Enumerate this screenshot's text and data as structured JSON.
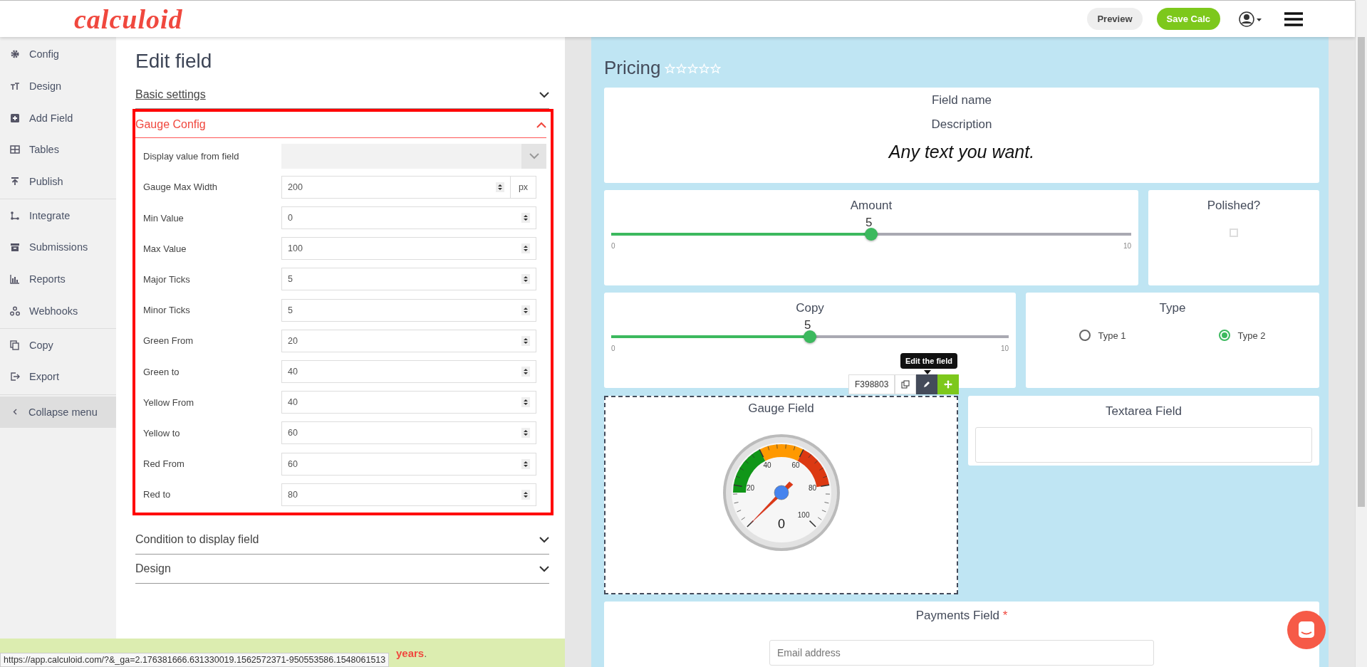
{
  "header": {
    "logo": "calculoid",
    "preview": "Preview",
    "save": "Save Calc"
  },
  "sidebar": {
    "groups": [
      [
        {
          "label": "Config"
        },
        {
          "label": "Design"
        },
        {
          "label": "Add Field"
        },
        {
          "label": "Tables"
        },
        {
          "label": "Publish"
        }
      ],
      [
        {
          "label": "Integrate"
        },
        {
          "label": "Submissions"
        },
        {
          "label": "Reports"
        },
        {
          "label": "Webhooks"
        }
      ],
      [
        {
          "label": "Copy"
        },
        {
          "label": "Export"
        }
      ]
    ],
    "collapse": "Collapse menu"
  },
  "editor": {
    "title": "Edit field",
    "sections": [
      {
        "title": "Basic settings",
        "expanded": false
      },
      {
        "title": "Gauge Config",
        "expanded": true,
        "fields": [
          {
            "kind": "select",
            "label": "Display value from field"
          },
          {
            "kind": "number",
            "label": "Gauge Max Width",
            "value": "200",
            "unit": "px"
          },
          {
            "kind": "number",
            "label": "Min Value",
            "value": "0"
          },
          {
            "kind": "number",
            "label": "Max Value",
            "value": "100"
          },
          {
            "kind": "number",
            "label": "Major Ticks",
            "value": "5"
          },
          {
            "kind": "number",
            "label": "Minor Ticks",
            "value": "5"
          },
          {
            "kind": "number",
            "label": "Green From",
            "value": "20"
          },
          {
            "kind": "number",
            "label": "Green to",
            "value": "40"
          },
          {
            "kind": "number",
            "label": "Yellow From",
            "value": "40"
          },
          {
            "kind": "number",
            "label": "Yellow to",
            "value": "60"
          },
          {
            "kind": "number",
            "label": "Red From",
            "value": "60"
          },
          {
            "kind": "number",
            "label": "Red to",
            "value": "80"
          }
        ]
      },
      {
        "title": "Condition to display field",
        "expanded": false
      },
      {
        "title": "Design",
        "expanded": false
      }
    ]
  },
  "banner": {
    "text": "**years**."
  },
  "status_url": "https://app.calculoid.com/?&_ga=2.176381666.631330019.1562572371-950553586.1548061513",
  "form": {
    "title": "Pricing",
    "stars": 0,
    "text_card": {
      "name": "Field name",
      "description": "Description",
      "text": "Any text you want."
    },
    "amount": {
      "label": "Amount",
      "value": "5",
      "level": 0.5,
      "min": "0",
      "max": "10"
    },
    "polished": {
      "label": "Polished?",
      "checked": false
    },
    "copy": {
      "label": "Copy",
      "value": "5",
      "level": 0.5,
      "min": "0",
      "max": "10"
    },
    "type": {
      "label": "Type",
      "options": [
        {
          "label": "Type 1",
          "selected": false
        },
        {
          "label": "Type 2",
          "selected": true
        }
      ]
    },
    "toolbar": {
      "id": "F398803",
      "tooltip": "Edit the field"
    },
    "gauge": {
      "label": "Gauge Field",
      "ticks": [
        "20",
        "40",
        "60",
        "80",
        "100"
      ],
      "reading": "0"
    },
    "textarea": {
      "label": "Textarea Field"
    },
    "payments": {
      "label": "Payments Field",
      "required_mark": "*",
      "placeholder": "Email address"
    }
  }
}
